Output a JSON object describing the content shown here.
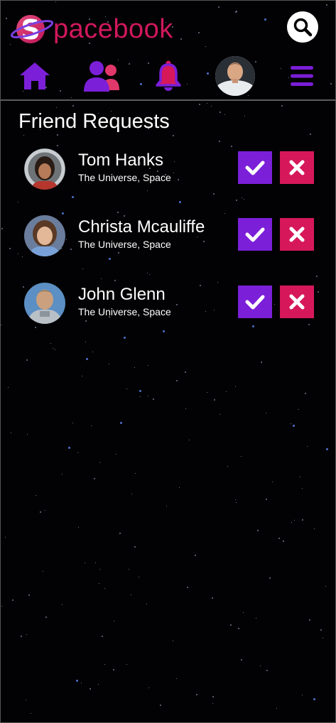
{
  "brand": {
    "name": "Spacebook",
    "logo_initial": "S",
    "logo_rest": "pacebook"
  },
  "header": {
    "search_icon": "search-icon"
  },
  "nav": {
    "items": [
      {
        "name": "home",
        "icon": "home-icon"
      },
      {
        "name": "friends",
        "icon": "friends-icon"
      },
      {
        "name": "notifications",
        "icon": "bell-icon"
      },
      {
        "name": "profile",
        "icon": "avatar"
      },
      {
        "name": "menu",
        "icon": "menu-icon"
      }
    ]
  },
  "page": {
    "title": "Friend Requests"
  },
  "requests": [
    {
      "name": "Tom Hanks",
      "location": "The Universe, Space"
    },
    {
      "name": "Christa Mcauliffe",
      "location": "The Universe, Space"
    },
    {
      "name": "John Glenn",
      "location": "The Universe, Space"
    }
  ],
  "colors": {
    "brand_pink": "#d0185c",
    "purple": "#7b1fd8",
    "pink_red": "#d6185a",
    "background": "#000000"
  }
}
